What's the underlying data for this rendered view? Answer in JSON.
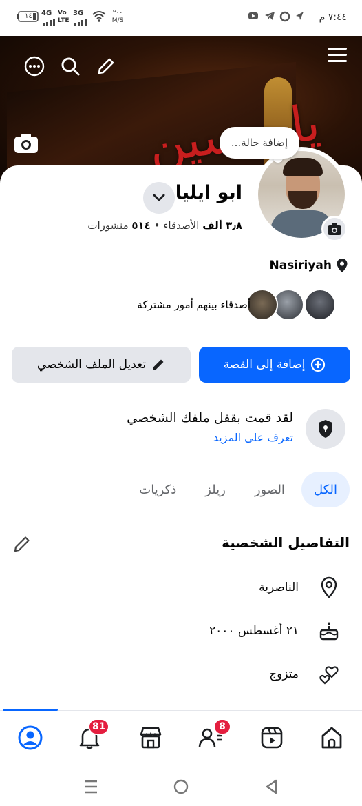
{
  "status_bar": {
    "time": "٧:٤٤ م",
    "battery": "١٤",
    "network_1": "4G",
    "network_2": "Vo LTE",
    "network_3": "3G",
    "speed": "٢٠٠ M/S"
  },
  "cover": {
    "overlay_text": "يا حسين"
  },
  "status_bubble": "إضافة حالة...",
  "profile": {
    "name": "ابو ايليا",
    "friends_count": "٣٫٨ ألف",
    "friends_label": "الأصدقاء",
    "separator": "•",
    "posts_count": "٥١٤",
    "posts_label": "منشورات",
    "location": "Nasiriyah",
    "mutual_text": "أصدقاء بينهم أمور مشتركة"
  },
  "buttons": {
    "add_story": "إضافة إلى القصة",
    "edit_profile": "تعديل الملف الشخصي"
  },
  "lock": {
    "title": "لقد قمت بقفل ملفك الشخصي",
    "link": "تعرف على المزيد"
  },
  "tabs": [
    {
      "label": "الكل",
      "active": true
    },
    {
      "label": "الصور",
      "active": false
    },
    {
      "label": "ريلز",
      "active": false
    },
    {
      "label": "ذكريات",
      "active": false
    }
  ],
  "details": {
    "title": "التفاصيل الشخصية",
    "items": [
      {
        "icon": "location-pin-icon",
        "text": "الناصرية"
      },
      {
        "icon": "cake-icon",
        "text": "٢١ أغسطس ٢٠٠٠"
      },
      {
        "icon": "hearts-icon",
        "text": "متزوج"
      }
    ]
  },
  "bottom_nav": {
    "notifications_badge": "81",
    "friends_badge": "8"
  },
  "colors": {
    "accent": "#0866ff",
    "badge": "#e41e3f",
    "secondary_button": "#e4e6eb"
  }
}
